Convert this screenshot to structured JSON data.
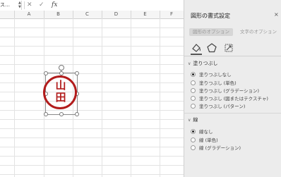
{
  "formula_bar": {
    "name_box": "ス…",
    "cancel_symbol": "✕",
    "enter_symbol": "✓",
    "fx_label": "fx"
  },
  "sheet": {
    "columns": [
      "A",
      "B",
      "C",
      "D",
      "E",
      "F"
    ]
  },
  "stamp": {
    "text": "山\n田",
    "line1": "山",
    "line2": "田",
    "color": "#b21c1c"
  },
  "panel": {
    "title": "図形の書式設定",
    "close_symbol": "×",
    "tabs": [
      {
        "label": "図形のオプション",
        "active": true
      },
      {
        "label": "文字のオプション",
        "active": false
      }
    ],
    "icon_tabs": [
      "fill-line-icon",
      "effects-pentagon-icon",
      "size-properties-icon"
    ],
    "fill_section": {
      "header": "塗りつぶし",
      "options": [
        {
          "label": "塗りつぶしなし",
          "checked": true
        },
        {
          "label": "塗りつぶし (単色)",
          "checked": false
        },
        {
          "label": "塗りつぶし (グラデーション)",
          "checked": false
        },
        {
          "label": "塗りつぶし (図またはテクスチャ)",
          "checked": false
        },
        {
          "label": "塗りつぶし (パターン)",
          "checked": false
        }
      ]
    },
    "line_section": {
      "header": "線",
      "options": [
        {
          "label": "線なし",
          "checked": true
        },
        {
          "label": "線 (単色)",
          "checked": false
        },
        {
          "label": "線 (グラデーション)",
          "checked": false
        }
      ]
    }
  }
}
